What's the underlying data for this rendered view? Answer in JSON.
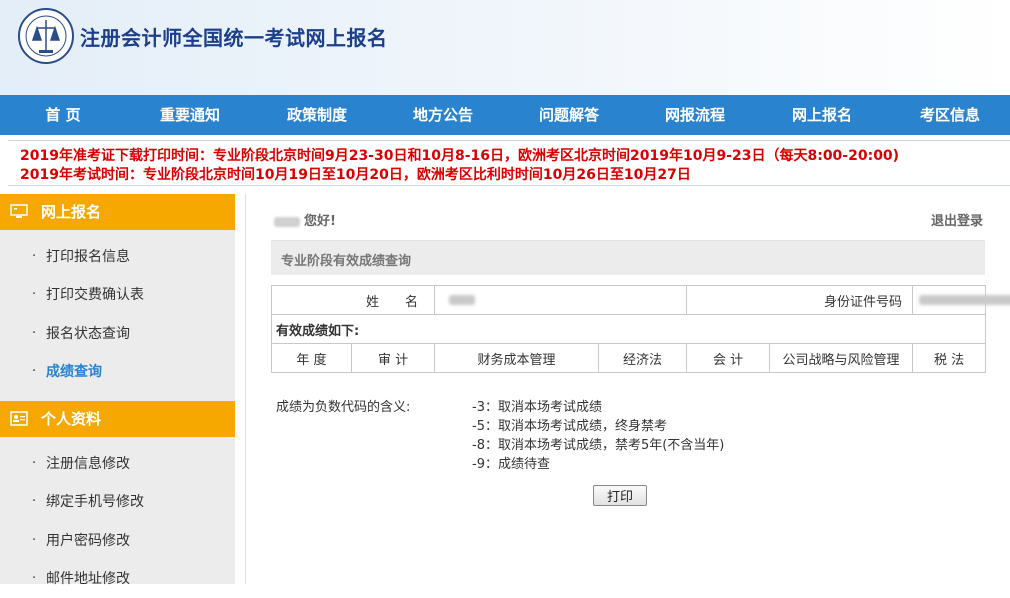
{
  "header": {
    "site_title": "注册会计师全国统一考试网上报名"
  },
  "nav": {
    "items": [
      {
        "label": "首  页"
      },
      {
        "label": "重要通知"
      },
      {
        "label": "政策制度"
      },
      {
        "label": "地方公告"
      },
      {
        "label": "问题解答"
      },
      {
        "label": "网报流程"
      },
      {
        "label": "网上报名"
      },
      {
        "label": "考区信息"
      }
    ]
  },
  "notice": {
    "line1": "2019年准考证下载打印时间：专业阶段北京时间9月23-30日和10月8-16日，欧洲考区北京时间2019年10月9-23日（每天8:00-20:00)",
    "line2": "2019年考试时间：专业阶段北京时间10月19日至10月20日，欧洲考区比利时时间10月26日至10月27日",
    "color": "#d90000"
  },
  "sidebar": {
    "section1": {
      "title": "网上报名",
      "icon": "monitor-icon",
      "items": [
        {
          "label": "打印报名信息"
        },
        {
          "label": "打印交费确认表"
        },
        {
          "label": "报名状态查询"
        },
        {
          "label": "成绩查询"
        }
      ]
    },
    "section2": {
      "title": "个人资料",
      "icon": "id-card-icon",
      "items": [
        {
          "label": "注册信息修改"
        },
        {
          "label": "绑定手机号修改"
        },
        {
          "label": "用户密码修改"
        },
        {
          "label": "邮件地址修改"
        }
      ]
    },
    "bullet": "·",
    "header_color": "#f6a800",
    "active_color": "#2a83cf"
  },
  "main": {
    "greeting": "您好!",
    "logout": "退出登录",
    "section_title": "专业阶段有效成绩查询",
    "name_label": "姓　　名",
    "id_label": "身份证件号码",
    "valid_scores_label": "有效成绩如下:",
    "subjects": [
      "年 度",
      "审 计",
      "财务成本管理",
      "经济法",
      "会 计",
      "公司战略与风险管理",
      "税 法"
    ],
    "legend_label": "成绩为负数代码的含义:",
    "codes": [
      "-3：取消本场考试成绩",
      "-5：取消本场考试成绩，终身禁考",
      "-8：取消本场考试成绩，禁考5年(不含当年)",
      "-9：成绩待查"
    ],
    "print_button": "打印"
  },
  "colors": {
    "nav_bg": "#2a83cf",
    "title_color": "#1b3f8b"
  }
}
